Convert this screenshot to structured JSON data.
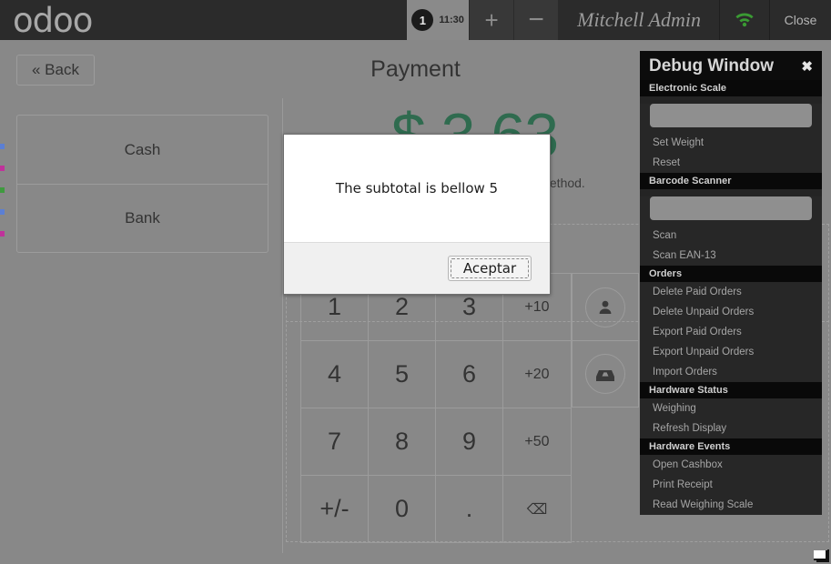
{
  "topbar": {
    "logo_text": "odoo",
    "order_tab": {
      "number": "1",
      "time": "11:30"
    },
    "add_order_label": "+",
    "remove_order_label": "−",
    "username": "Mitchell Admin",
    "wifi_icon": "wifi-icon",
    "close_label": "Close"
  },
  "header": {
    "back_label": "« Back",
    "title": "Payment"
  },
  "payment_methods": [
    {
      "label": "Cash"
    },
    {
      "label": "Bank"
    }
  ],
  "amount": {
    "due": "$ 3.63",
    "hint": "Select a payment method."
  },
  "keypad": [
    {
      "label": "1",
      "size": "big"
    },
    {
      "label": "2",
      "size": "big"
    },
    {
      "label": "3",
      "size": "big"
    },
    {
      "label": "+10",
      "size": "small"
    },
    {
      "label": "4",
      "size": "big"
    },
    {
      "label": "5",
      "size": "big"
    },
    {
      "label": "6",
      "size": "big"
    },
    {
      "label": "+20",
      "size": "small"
    },
    {
      "label": "7",
      "size": "big"
    },
    {
      "label": "8",
      "size": "big"
    },
    {
      "label": "9",
      "size": "big"
    },
    {
      "label": "+50",
      "size": "small"
    },
    {
      "label": "+/-",
      "size": "big"
    },
    {
      "label": "0",
      "size": "big"
    },
    {
      "label": ".",
      "size": "big"
    },
    {
      "label": "⌫",
      "size": "small"
    }
  ],
  "side_actions": [
    {
      "icon": "customer-icon"
    },
    {
      "icon": "email-icon"
    }
  ],
  "debug_window": {
    "title": "Debug Window",
    "close_label": "✖",
    "sections": [
      {
        "title": "Electronic Scale",
        "has_input": true,
        "input_value": "",
        "items": [
          "Set Weight",
          "Reset"
        ]
      },
      {
        "title": "Barcode Scanner",
        "has_input": true,
        "input_value": "",
        "items": [
          "Scan",
          "Scan EAN-13"
        ]
      },
      {
        "title": "Orders",
        "has_input": false,
        "items": [
          "Delete Paid Orders",
          "Delete Unpaid Orders",
          "Export Paid Orders",
          "Export Unpaid Orders",
          "Import Orders"
        ]
      },
      {
        "title": "Hardware Status",
        "has_input": false,
        "items": [
          "Weighing",
          "Refresh Display"
        ]
      },
      {
        "title": "Hardware Events",
        "has_input": false,
        "items": [
          "Open Cashbox",
          "Print Receipt",
          "Read Weighing Scale"
        ]
      }
    ]
  },
  "alert": {
    "message": "The subtotal is bellow 5",
    "ok_label": "Aceptar"
  },
  "colors": {
    "topbar_bg": "#2b2b2b",
    "page_bg": "#888888",
    "amount_green": "#2f6b4f",
    "wifi_green": "#3a9a33",
    "debug_bg": "#141414"
  }
}
